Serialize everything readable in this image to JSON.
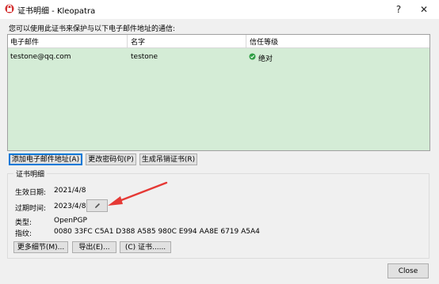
{
  "window": {
    "title": "证书明细 - Kleopatra",
    "help": "?",
    "close": "✕"
  },
  "description": "您可以使用此证书来保护与以下电子邮件地址的通信:",
  "table": {
    "columns": [
      "电子邮件",
      "名字",
      "信任等级"
    ],
    "rows": [
      {
        "email": "testone@qq.com",
        "name": "testone",
        "trust": "绝对"
      }
    ]
  },
  "actions": {
    "add_email": "添加电子邮件地址(A)",
    "change_pass": "更改密码句(P)",
    "revoke": "生成吊销证书(R)"
  },
  "details": {
    "title": "证书明细",
    "valid_from_label": "生效日期:",
    "valid_from": "2021/4/8",
    "expires_label": "过期时间:",
    "expires": "2023/4/8",
    "type_label": "类型:",
    "type": "OpenPGP",
    "fingerprint_label": "指纹:",
    "fingerprint": "0080 33FC C5A1 D388 A585 980C E994 AA8E 6719 A5A4"
  },
  "bottom": {
    "more": "更多细节(M)...",
    "export": "导出(E)...",
    "cert": "(C) 证书......",
    "close": "Close"
  },
  "colors": {
    "accent": "#0078d7",
    "arrow": "#e53935",
    "selection": "#d4ecd6"
  }
}
